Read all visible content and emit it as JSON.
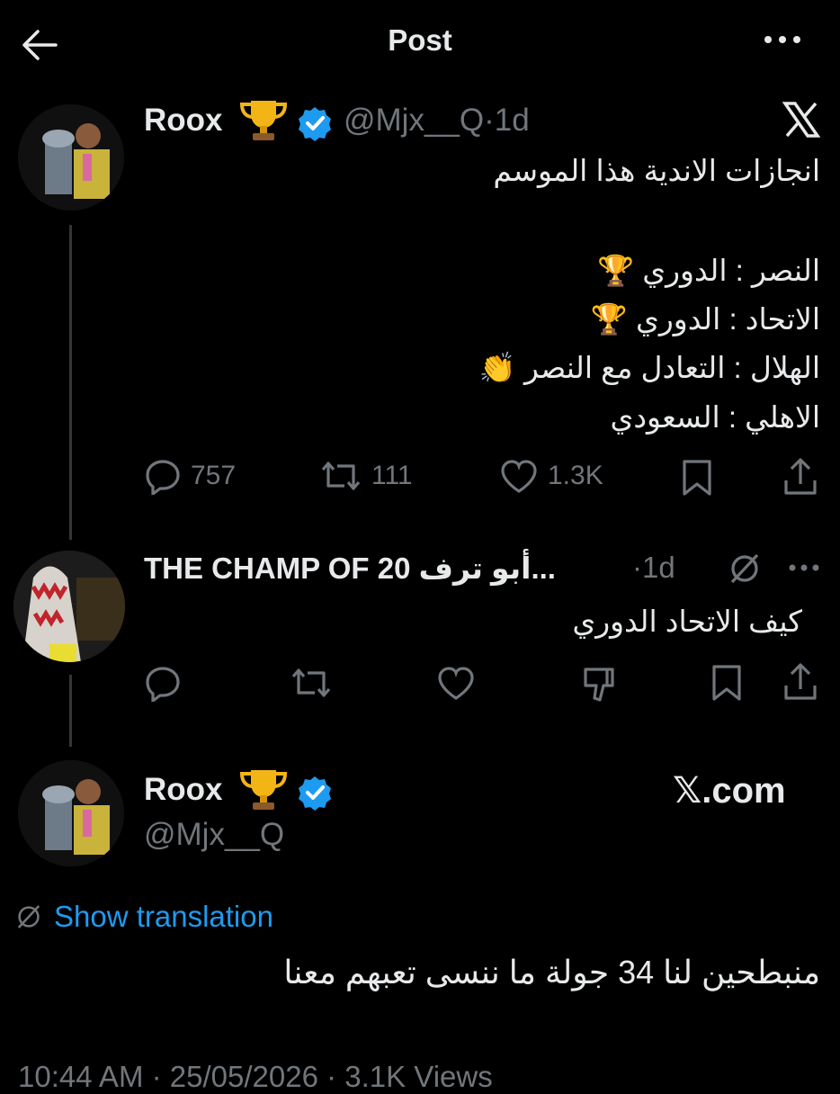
{
  "header": {
    "title": "Post"
  },
  "tweet1": {
    "name": "Roox",
    "handle": "@Mjx__Q",
    "time": "·1d",
    "lines": [
      "انجازات الاندية هذا الموسم",
      "",
      "النصر : الدوري 🏆",
      "الاتحاد : الدوري 🏆",
      "الهلال : التعادل مع النصر 👏",
      "الاهلي : السعودي"
    ],
    "replies": "757",
    "retweets": "111",
    "likes": "1.3K"
  },
  "reply": {
    "name": "THE CHAMP OF 20 أبو ترف...",
    "time": "·1d",
    "text": "كيف الاتحاد الدوري"
  },
  "main": {
    "name": "Roox",
    "handle": "@Mjx__Q",
    "brand": "𝕏.com",
    "show_translation": "Show translation",
    "text": "منبطحين لنا 34 جولة ما ننسى تعبهم معنا",
    "footer": "10:44 AM · 25/05/2026 · 3.1K Views"
  },
  "icons": {
    "trophy": "trophy-emoji",
    "clap": "clapping-hands-emoji",
    "verified": "verified-badge-icon",
    "x_logo": "x-logo-icon"
  }
}
